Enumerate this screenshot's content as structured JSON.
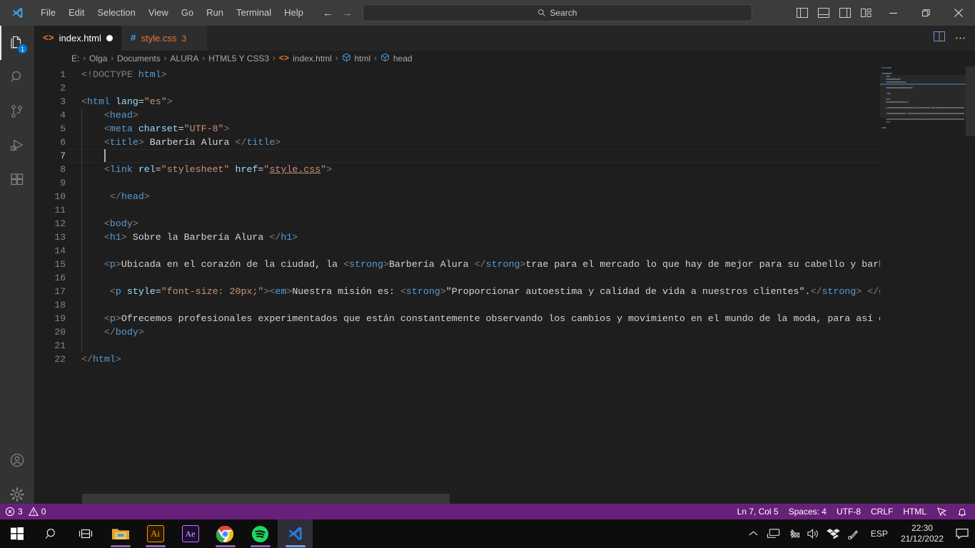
{
  "titlebar": {
    "logo_icon": "vscode-logo-icon",
    "menus": [
      "File",
      "Edit",
      "Selection",
      "View",
      "Go",
      "Run",
      "Terminal",
      "Help"
    ],
    "back_icon": "arrow-left-icon",
    "forward_icon": "arrow-right-icon",
    "search": {
      "placeholder": "Search",
      "value": "Search",
      "icon": "search-icon"
    },
    "layout_icons": [
      "toggle-primary-sidebar-icon",
      "toggle-panel-icon",
      "toggle-secondary-sidebar-icon",
      "customize-layout-icon"
    ],
    "window_buttons": {
      "minimize": "minimize-icon",
      "maximize": "maximize-icon",
      "close": "close-icon"
    }
  },
  "activitybar": {
    "items": [
      {
        "name": "explorer",
        "icon": "files-icon",
        "badge": "1",
        "active": true
      },
      {
        "name": "search",
        "icon": "search-icon",
        "badge": "",
        "active": false
      },
      {
        "name": "source-control",
        "icon": "source-control-icon",
        "badge": "",
        "active": false
      },
      {
        "name": "run-and-debug",
        "icon": "run-and-debug-icon",
        "badge": "",
        "active": false
      },
      {
        "name": "extensions",
        "icon": "extensions-icon",
        "badge": "",
        "active": false
      }
    ],
    "bottom": [
      {
        "name": "accounts",
        "icon": "account-icon"
      },
      {
        "name": "manage",
        "icon": "gear-icon"
      }
    ]
  },
  "tabs": [
    {
      "label": "index.html",
      "icon": "html-file-icon",
      "dirty": true,
      "active": true,
      "count": ""
    },
    {
      "label": "style.css",
      "icon": "css-file-icon",
      "dirty": false,
      "active": false,
      "count": "3"
    }
  ],
  "tabbar_actions": [
    "split-editor-icon",
    "more-actions-icon"
  ],
  "breadcrumb": {
    "items": [
      "E:",
      "Olga",
      "Documents",
      "ALURA",
      "HTML5 Y CSS3",
      "index.html",
      "html",
      "head"
    ],
    "separator": "›"
  },
  "editor": {
    "line_count": 22,
    "current_line": 7,
    "lines": [
      {
        "n": 1,
        "indent": 0,
        "tokens": [
          {
            "c": "t-doctype",
            "t": "<!DOCTYPE "
          },
          {
            "c": "t-doctype-name",
            "t": "html"
          },
          {
            "c": "t-doctype",
            "t": ">"
          }
        ]
      },
      {
        "n": 2,
        "indent": 0,
        "tokens": []
      },
      {
        "n": 3,
        "indent": 0,
        "tokens": [
          {
            "c": "t-brk",
            "t": "<"
          },
          {
            "c": "t-tag",
            "t": "html"
          },
          {
            "c": "t-txt",
            "t": " "
          },
          {
            "c": "t-attr",
            "t": "lang"
          },
          {
            "c": "t-eq",
            "t": "="
          },
          {
            "c": "t-str",
            "t": "\"es\""
          },
          {
            "c": "t-brk",
            "t": ">"
          }
        ]
      },
      {
        "n": 4,
        "indent": 1,
        "pad": "    ",
        "tokens": [
          {
            "c": "t-brk",
            "t": "<"
          },
          {
            "c": "t-tag",
            "t": "head"
          },
          {
            "c": "t-brk",
            "t": ">"
          }
        ]
      },
      {
        "n": 5,
        "indent": 1,
        "pad": "    ",
        "tokens": [
          {
            "c": "t-brk",
            "t": "<"
          },
          {
            "c": "t-tag",
            "t": "meta"
          },
          {
            "c": "t-txt",
            "t": " "
          },
          {
            "c": "t-attr",
            "t": "charset"
          },
          {
            "c": "t-eq",
            "t": "="
          },
          {
            "c": "t-str",
            "t": "\"UTF-8\""
          },
          {
            "c": "t-brk",
            "t": ">"
          }
        ]
      },
      {
        "n": 6,
        "indent": 1,
        "pad": "    ",
        "tokens": [
          {
            "c": "t-brk",
            "t": "<"
          },
          {
            "c": "t-tag",
            "t": "title"
          },
          {
            "c": "t-brk",
            "t": ">"
          },
          {
            "c": "t-txt",
            "t": " Barbería Alura "
          },
          {
            "c": "t-brk",
            "t": "</"
          },
          {
            "c": "t-tag",
            "t": "title"
          },
          {
            "c": "t-brk",
            "t": ">"
          }
        ]
      },
      {
        "n": 7,
        "indent": 1,
        "pad": "    ",
        "tokens": [],
        "cursor": true
      },
      {
        "n": 8,
        "indent": 1,
        "pad": "    ",
        "tokens": [
          {
            "c": "t-brk",
            "t": "<"
          },
          {
            "c": "t-tag",
            "t": "link"
          },
          {
            "c": "t-txt",
            "t": " "
          },
          {
            "c": "t-attr",
            "t": "rel"
          },
          {
            "c": "t-eq",
            "t": "="
          },
          {
            "c": "t-str",
            "t": "\"stylesheet\""
          },
          {
            "c": "t-txt",
            "t": " "
          },
          {
            "c": "t-attr",
            "t": "href"
          },
          {
            "c": "t-eq",
            "t": "="
          },
          {
            "c": "t-str",
            "t": "\""
          },
          {
            "c": "t-link",
            "t": "style.css"
          },
          {
            "c": "t-str",
            "t": "\""
          },
          {
            "c": "t-brk",
            "t": ">"
          }
        ]
      },
      {
        "n": 9,
        "indent": 1,
        "tokens": []
      },
      {
        "n": 10,
        "indent": 1,
        "pad": "     ",
        "tokens": [
          {
            "c": "t-brk",
            "t": "</"
          },
          {
            "c": "t-tag",
            "t": "head"
          },
          {
            "c": "t-brk",
            "t": ">"
          }
        ]
      },
      {
        "n": 11,
        "indent": 1,
        "tokens": []
      },
      {
        "n": 12,
        "indent": 1,
        "pad": "    ",
        "tokens": [
          {
            "c": "t-brk",
            "t": "<"
          },
          {
            "c": "t-tag",
            "t": "body"
          },
          {
            "c": "t-brk",
            "t": ">"
          }
        ]
      },
      {
        "n": 13,
        "indent": 1,
        "pad": "    ",
        "tokens": [
          {
            "c": "t-brk",
            "t": "<"
          },
          {
            "c": "t-tag",
            "t": "h1"
          },
          {
            "c": "t-brk",
            "t": ">"
          },
          {
            "c": "t-txt",
            "t": " Sobre la Barbería Alura "
          },
          {
            "c": "t-brk",
            "t": "</"
          },
          {
            "c": "t-tag",
            "t": "h1"
          },
          {
            "c": "t-brk",
            "t": ">"
          }
        ]
      },
      {
        "n": 14,
        "indent": 1,
        "tokens": []
      },
      {
        "n": 15,
        "indent": 1,
        "pad": "    ",
        "tokens": [
          {
            "c": "t-brk",
            "t": "<"
          },
          {
            "c": "t-tag",
            "t": "p"
          },
          {
            "c": "t-brk",
            "t": ">"
          },
          {
            "c": "t-txt",
            "t": "Ubicada en el corazón de la ciudad, la "
          },
          {
            "c": "t-brk",
            "t": "<"
          },
          {
            "c": "t-tag",
            "t": "strong"
          },
          {
            "c": "t-brk",
            "t": ">"
          },
          {
            "c": "t-txt",
            "t": "Barbería Alura "
          },
          {
            "c": "t-brk",
            "t": "</"
          },
          {
            "c": "t-tag",
            "t": "strong"
          },
          {
            "c": "t-brk",
            "t": ">"
          },
          {
            "c": "t-txt",
            "t": "trae para el mercado lo que hay de mejor para su cabello y barba. P"
          }
        ]
      },
      {
        "n": 16,
        "indent": 1,
        "tokens": []
      },
      {
        "n": 17,
        "indent": 1,
        "pad": "     ",
        "tokens": [
          {
            "c": "t-brk",
            "t": "<"
          },
          {
            "c": "t-tag",
            "t": "p"
          },
          {
            "c": "t-txt",
            "t": " "
          },
          {
            "c": "t-attr",
            "t": "style"
          },
          {
            "c": "t-eq",
            "t": "="
          },
          {
            "c": "t-str",
            "t": "\"font-size: 20px;\""
          },
          {
            "c": "t-brk",
            "t": ">"
          },
          {
            "c": "t-brk",
            "t": "<"
          },
          {
            "c": "t-tag",
            "t": "em"
          },
          {
            "c": "t-brk",
            "t": ">"
          },
          {
            "c": "t-txt",
            "t": "Nuestra misión es: "
          },
          {
            "c": "t-brk",
            "t": "<"
          },
          {
            "c": "t-tag",
            "t": "strong"
          },
          {
            "c": "t-brk",
            "t": ">"
          },
          {
            "c": "t-txt",
            "t": "\"Proporcionar autoestima y calidad de vida a nuestros clientes\"."
          },
          {
            "c": "t-brk",
            "t": "</"
          },
          {
            "c": "t-tag",
            "t": "strong"
          },
          {
            "c": "t-brk",
            "t": ">"
          },
          {
            "c": "t-txt",
            "t": " "
          },
          {
            "c": "t-brk",
            "t": "</"
          },
          {
            "c": "t-tag",
            "t": "em"
          },
          {
            "c": "t-brk",
            "t": ">"
          },
          {
            "c": "t-brk",
            "t": "</"
          }
        ]
      },
      {
        "n": 18,
        "indent": 1,
        "tokens": []
      },
      {
        "n": 19,
        "indent": 1,
        "pad": "    ",
        "tokens": [
          {
            "c": "t-brk",
            "t": "<"
          },
          {
            "c": "t-tag",
            "t": "p"
          },
          {
            "c": "t-brk",
            "t": ">"
          },
          {
            "c": "t-txt",
            "t": "Ofrecemos profesionales experimentados que están constantemente observando los cambios y movimiento en el mundo de la moda, para así ofrec"
          }
        ]
      },
      {
        "n": 20,
        "indent": 1,
        "pad": "    ",
        "tokens": [
          {
            "c": "t-brk",
            "t": "</"
          },
          {
            "c": "t-tag",
            "t": "body"
          },
          {
            "c": "t-brk",
            "t": ">"
          }
        ]
      },
      {
        "n": 21,
        "indent": 1,
        "tokens": []
      },
      {
        "n": 22,
        "indent": 0,
        "tokens": [
          {
            "c": "t-brk",
            "t": "</"
          },
          {
            "c": "t-tag",
            "t": "html"
          },
          {
            "c": "t-brk",
            "t": ">"
          }
        ]
      }
    ]
  },
  "statusbar": {
    "errors": {
      "icon": "error-icon",
      "count": "3"
    },
    "warnings": {
      "icon": "warning-icon",
      "count": "0"
    },
    "position": "Ln 7, Col 5",
    "indentation": "Spaces: 4",
    "encoding": "UTF-8",
    "eol": "CRLF",
    "language": "HTML",
    "feedback_icon": "feedback-icon",
    "bell_icon": "bell-icon",
    "background": "#68217a"
  },
  "taskbar": {
    "start_icon": "windows-start-icon",
    "search_icon": "search-icon",
    "taskview_icon": "task-view-icon",
    "apps": [
      {
        "name": "file-explorer",
        "label": "",
        "open": true,
        "focused": false
      },
      {
        "name": "adobe-illustrator",
        "label": "Ai",
        "open": true,
        "focused": false
      },
      {
        "name": "adobe-after-effects",
        "label": "Ae",
        "open": false,
        "focused": false
      },
      {
        "name": "google-chrome",
        "label": "",
        "open": true,
        "focused": false
      },
      {
        "name": "spotify",
        "label": "",
        "open": true,
        "focused": false
      },
      {
        "name": "visual-studio-code",
        "label": "",
        "open": true,
        "focused": true
      }
    ],
    "tray": {
      "chevron_icon": "show-hidden-icons-icon",
      "network_icon": "network-icon",
      "bluetooth_icon": "bluetooth-icon",
      "volume_icon": "volume-icon",
      "dropbox_icon": "dropbox-icon",
      "onedrive_icon": "pen-icon",
      "language": "ESP",
      "time": "22:30",
      "date": "21/12/2022",
      "notifications_icon": "notifications-icon"
    }
  },
  "colors": {
    "accent_purple": "#68217a",
    "editor_bg": "#1e1e1e",
    "titlebar_bg": "#3c3c3c",
    "activitybar_bg": "#333333",
    "tabbar_bg": "#252526",
    "badge_blue": "#0078d4",
    "html_orange": "#e37933",
    "css_blue": "#42a5f5"
  }
}
